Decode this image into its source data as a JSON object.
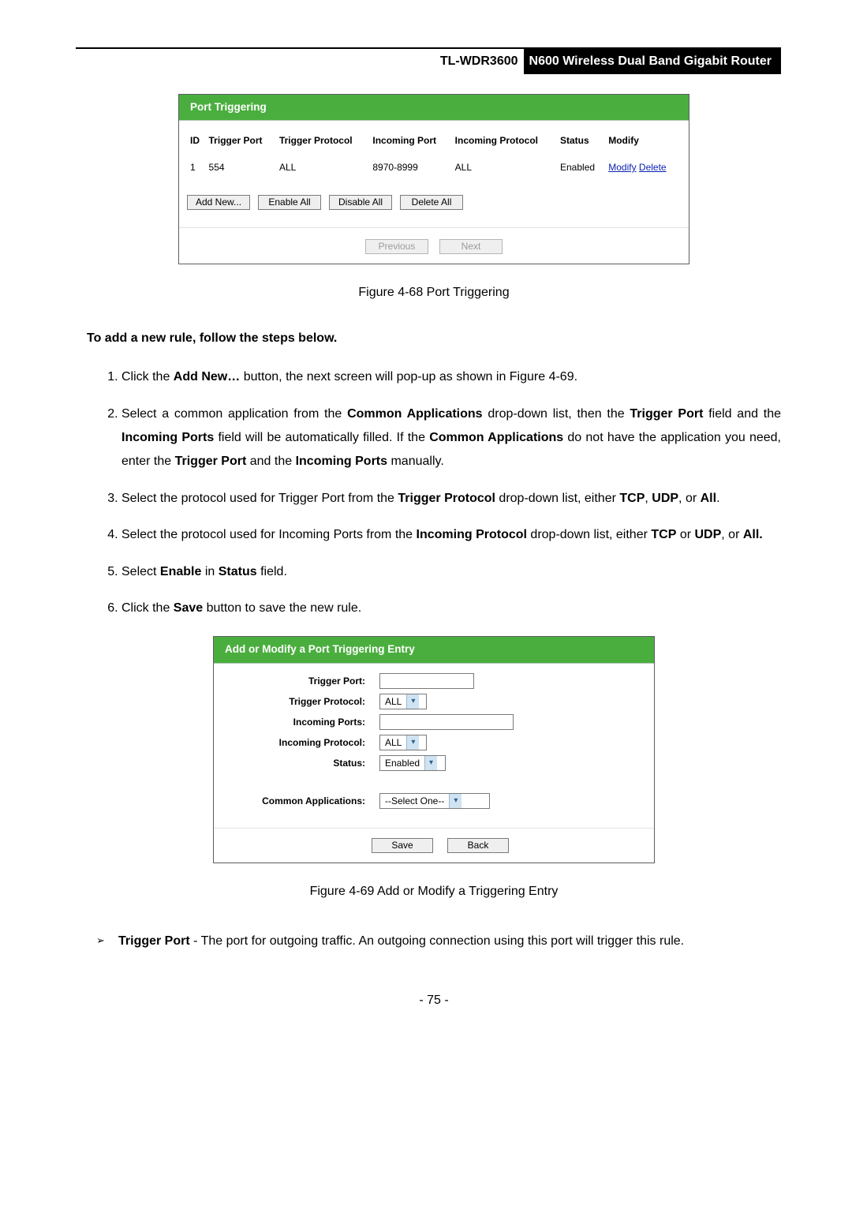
{
  "header": {
    "model": "TL-WDR3600",
    "desc": "N600 Wireless Dual Band Gigabit Router"
  },
  "panel1": {
    "title": "Port Triggering",
    "columns": {
      "id": "ID",
      "tport": "Trigger Port",
      "tproto": "Trigger Protocol",
      "iport": "Incoming Port",
      "iproto": "Incoming Protocol",
      "status": "Status",
      "modify": "Modify"
    },
    "rows": [
      {
        "id": "1",
        "tport": "554",
        "tproto": "ALL",
        "iport": "8970-8999",
        "iproto": "ALL",
        "status": "Enabled",
        "mod": "Modify",
        "del": "Delete"
      }
    ],
    "buttons": {
      "add": "Add New...",
      "enable": "Enable All",
      "disable": "Disable All",
      "delete": "Delete All"
    },
    "pager": {
      "prev": "Previous",
      "next": "Next"
    }
  },
  "caption1": "Figure 4-68 Port Triggering",
  "section_heading": "To add a new rule, follow the steps below.",
  "steps": {
    "s1a": "Click the ",
    "s1b": "Add New…",
    "s1c": " button, the next screen will pop-up as shown in Figure 4-69.",
    "s2a": "Select a common application from the ",
    "s2b": "Common Applications",
    "s2c": " drop-down list, then the ",
    "s2d": "Trigger Port",
    "s2e": " field and the ",
    "s2f": "Incoming Ports",
    "s2g": " field will be automatically filled. If the ",
    "s2h": "Common Applications",
    "s2i": " do not have the application you need, enter the ",
    "s2j": "Trigger Port",
    "s2k": " and the ",
    "s2l": "Incoming Ports",
    "s2m": " manually.",
    "s3a": "Select the protocol used for Trigger Port from the ",
    "s3b": "Trigger Protocol",
    "s3c": " drop-down list, either ",
    "s3d": "TCP",
    "s3e": ", ",
    "s3f": "UDP",
    "s3g": ", or ",
    "s3h": "All",
    "s3i": ".",
    "s4a": "Select the protocol used for Incoming Ports from the ",
    "s4b": "Incoming Protocol",
    "s4c": " drop-down list, either ",
    "s4d": "TCP",
    "s4e": " or ",
    "s4f": "UDP",
    "s4g": ", or ",
    "s4h": "All.",
    "s5a": "Select ",
    "s5b": "Enable",
    "s5c": " in ",
    "s5d": "Status",
    "s5e": " field.",
    "s6a": "Click the ",
    "s6b": "Save",
    "s6c": " button to save the new rule."
  },
  "panel2": {
    "title": "Add or Modify a Port Triggering Entry",
    "labels": {
      "tport": "Trigger Port:",
      "tproto": "Trigger Protocol:",
      "iports": "Incoming Ports:",
      "iproto": "Incoming Protocol:",
      "status": "Status:",
      "capps": "Common Applications:"
    },
    "values": {
      "tproto": "ALL",
      "iproto": "ALL",
      "status": "Enabled",
      "capps": "--Select One--"
    },
    "buttons": {
      "save": "Save",
      "back": "Back"
    }
  },
  "caption2": "Figure 4-69 Add or Modify a Triggering Entry",
  "note": {
    "t": "Trigger Port",
    "rest": " - The port for outgoing traffic. An outgoing connection using this port will trigger this rule."
  },
  "pagenum": "- 75 -"
}
